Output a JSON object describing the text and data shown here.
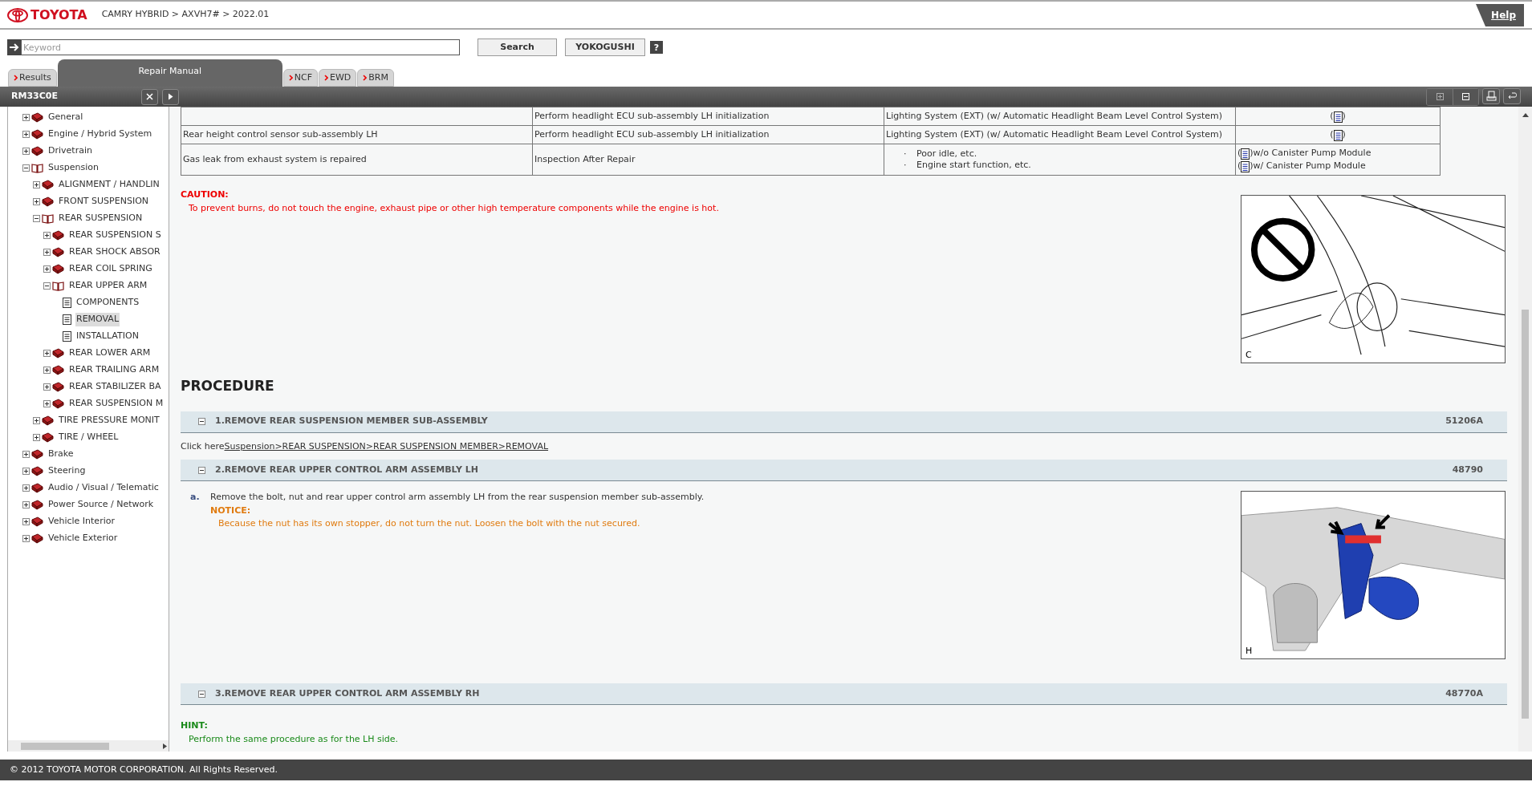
{
  "header": {
    "brand": "TOYOTA",
    "breadcrumb": "CAMRY HYBRID > AXVH7# > 2022.01",
    "help": "Help"
  },
  "search": {
    "placeholder": "Keyword",
    "search_button": "Search",
    "yokogushi_button": "YOKOGUSHI",
    "help_button": "?"
  },
  "tabs": [
    {
      "label": "Results",
      "selected": false
    },
    {
      "label": "Repair Manual",
      "selected": true
    },
    {
      "label": "NCF",
      "selected": false
    },
    {
      "label": "EWD",
      "selected": false
    },
    {
      "label": "BRM",
      "selected": false
    }
  ],
  "panel": {
    "title": "RM33C0E"
  },
  "tree": [
    {
      "label": "General",
      "kind": "book",
      "expanded": false,
      "selected": false
    },
    {
      "label": "Engine / Hybrid System",
      "kind": "book",
      "expanded": false,
      "selected": false
    },
    {
      "label": "Drivetrain",
      "kind": "book",
      "expanded": false,
      "selected": false
    },
    {
      "label": "Suspension",
      "kind": "book",
      "expanded": true,
      "selected": false,
      "children": [
        {
          "label": "ALIGNMENT / HANDLIN",
          "kind": "book",
          "expanded": false,
          "selected": false
        },
        {
          "label": "FRONT SUSPENSION",
          "kind": "book",
          "expanded": false,
          "selected": false
        },
        {
          "label": "REAR SUSPENSION",
          "kind": "book",
          "expanded": true,
          "selected": false,
          "children": [
            {
              "label": "REAR SUSPENSION S",
              "kind": "book",
              "expanded": false,
              "selected": false
            },
            {
              "label": "REAR SHOCK ABSOR",
              "kind": "book",
              "expanded": false,
              "selected": false
            },
            {
              "label": "REAR COIL SPRING",
              "kind": "book",
              "expanded": false,
              "selected": false
            },
            {
              "label": "REAR UPPER ARM",
              "kind": "book",
              "expanded": true,
              "selected": false,
              "children": [
                {
                  "label": "COMPONENTS",
                  "kind": "page",
                  "selected": false
                },
                {
                  "label": "REMOVAL",
                  "kind": "page",
                  "selected": true
                },
                {
                  "label": "INSTALLATION",
                  "kind": "page",
                  "selected": false
                }
              ]
            },
            {
              "label": "REAR LOWER ARM",
              "kind": "book",
              "expanded": false,
              "selected": false
            },
            {
              "label": "REAR TRAILING ARM",
              "kind": "book",
              "expanded": false,
              "selected": false
            },
            {
              "label": "REAR STABILIZER BA",
              "kind": "book",
              "expanded": false,
              "selected": false
            },
            {
              "label": "REAR SUSPENSION M",
              "kind": "book",
              "expanded": false,
              "selected": false
            }
          ]
        },
        {
          "label": "TIRE PRESSURE MONIT",
          "kind": "book",
          "expanded": false,
          "selected": false
        },
        {
          "label": "TIRE / WHEEL",
          "kind": "book",
          "expanded": false,
          "selected": false
        }
      ]
    },
    {
      "label": "Brake",
      "kind": "book",
      "expanded": false,
      "selected": false
    },
    {
      "label": "Steering",
      "kind": "book",
      "expanded": false,
      "selected": false
    },
    {
      "label": "Audio / Visual / Telematic",
      "kind": "book",
      "expanded": false,
      "selected": false
    },
    {
      "label": "Power Source / Network",
      "kind": "book",
      "expanded": false,
      "selected": false
    },
    {
      "label": "Vehicle Interior",
      "kind": "book",
      "expanded": false,
      "selected": false
    },
    {
      "label": "Vehicle Exterior",
      "kind": "book",
      "expanded": false,
      "selected": false
    }
  ],
  "table": {
    "rows": [
      {
        "procedure": "Perform headlight ECU sub-assembly LH initialization",
        "system": [
          "Lighting System (EXT) (w/ Automatic Headlight Beam Level Control System)"
        ],
        "links": [
          {
            "before": "(",
            "after": ")"
          }
        ]
      },
      {
        "part": "Rear height control sensor sub-assembly LH",
        "procedure": "Perform headlight ECU sub-assembly LH initialization",
        "system": [
          "Lighting System (EXT) (w/ Automatic Headlight Beam Level Control System)"
        ],
        "links": [
          {
            "before": "(",
            "after": ")"
          }
        ]
      },
      {
        "part": "Gas leak from exhaust system is repaired",
        "procedure": "Inspection After Repair",
        "bullets": [
          "Poor idle, etc.",
          "Engine start function, etc."
        ],
        "bullet_mark": "·",
        "links": [
          {
            "before": "(",
            "after": ")w/o Canister Pump Module"
          },
          {
            "before": "(",
            "after": ")w/ Canister Pump Module"
          }
        ]
      }
    ]
  },
  "caution": {
    "title": "CAUTION:",
    "text": "To prevent burns, do not touch the engine, exhaust pipe or other high temperature components while the engine is hot.",
    "figure_label": "C"
  },
  "procedure_title": "PROCEDURE",
  "steps": [
    {
      "title": "1.REMOVE REAR SUSPENSION MEMBER SUB-ASSEMBLY",
      "code": "51206A",
      "expanded": true,
      "link_prefix": "Click here",
      "link": "Suspension>REAR SUSPENSION>REAR SUSPENSION MEMBER>REMOVAL"
    },
    {
      "title": "2.REMOVE REAR UPPER CONTROL ARM ASSEMBLY LH",
      "code": "48790",
      "expanded": true,
      "item_mark": "a.",
      "item_text": "Remove the bolt, nut and rear upper control arm assembly LH from the rear suspension member sub-assembly.",
      "notice_title": "NOTICE:",
      "notice_text": "Because the nut has its own stopper, do not turn the nut. Loosen the bolt with the nut secured.",
      "figure_label": "H"
    },
    {
      "title": "3.REMOVE REAR UPPER CONTROL ARM ASSEMBLY RH",
      "code": "48770A",
      "expanded": true
    }
  ],
  "hint": {
    "title": "HINT:",
    "text": "Perform the same procedure as for the LH side."
  },
  "footer": "© 2012 TOYOTA MOTOR CORPORATION. All Rights Reserved."
}
